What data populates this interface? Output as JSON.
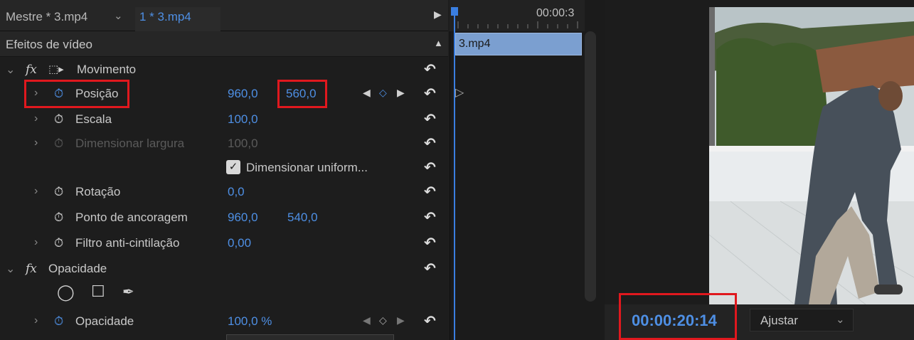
{
  "effect_controls": {
    "tabs": {
      "master_clip": "Mestre * 3.mp4",
      "sequence_clip": "1 * 3.mp4"
    },
    "timecode_ruler": "00:00:3",
    "section_title": "Efeitos de vídeo",
    "motion": {
      "label": "Movimento",
      "properties": [
        {
          "key": "position",
          "label": "Posição",
          "value1": "960,0",
          "value2": "560,0",
          "animated": true
        },
        {
          "key": "scale",
          "label": "Escala",
          "value1": "100,0"
        },
        {
          "key": "scale_width",
          "label": "Dimensionar largura",
          "value1": "100,0",
          "disabled": true
        },
        {
          "key": "uniform",
          "label": "Dimensionar uniform...",
          "checked": true
        },
        {
          "key": "rotation",
          "label": "Rotação",
          "value1": "0,0"
        },
        {
          "key": "anchor",
          "label": "Ponto de ancoragem",
          "value1": "960,0",
          "value2": "540,0"
        },
        {
          "key": "flicker",
          "label": "Filtro anti-cintilação",
          "value1": "0,00"
        }
      ]
    },
    "opacity": {
      "label": "Opacidade",
      "property_label": "Opacidade",
      "property_value": "100,0 %"
    }
  },
  "timeline": {
    "clip_name": "3.mp4"
  },
  "program_monitor": {
    "timecode": "00:00:20:14",
    "fit_dropdown": "Ajustar"
  },
  "colors": {
    "accent": "#4e8fe4",
    "highlight_box": "#e0181e",
    "clip": "#7b9fd0"
  }
}
